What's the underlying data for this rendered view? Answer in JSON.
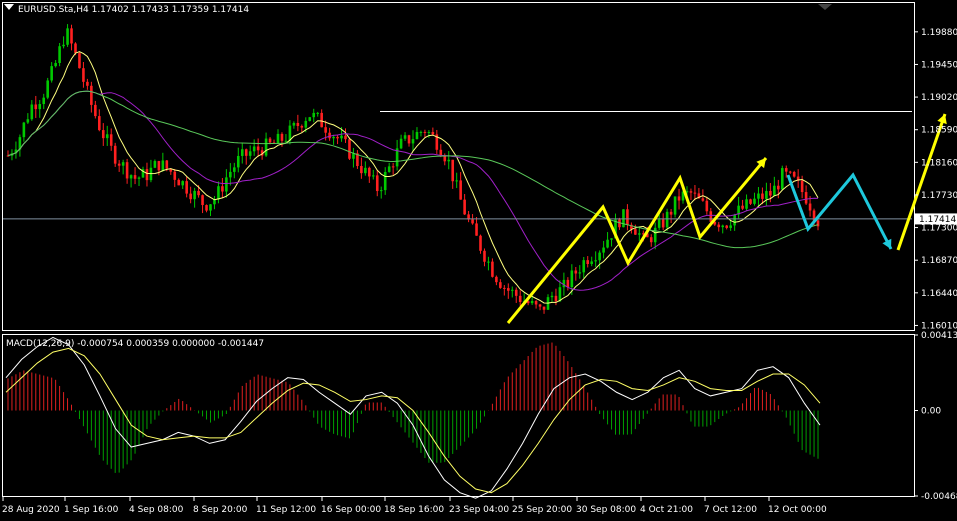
{
  "header": {
    "symbol_line": "EURUSD.Sta,H4  1.17402 1.17433 1.17359 1.17414"
  },
  "macd": {
    "label": "MACD(12,26,9) -0.000754 0.000359 0.000000 -0.001447",
    "levels": [
      "0.004136",
      "0.00",
      "-0.004681"
    ]
  },
  "colors": {
    "background": "#000000",
    "bull": "#00c800",
    "bear": "#ff2020",
    "ma_fast": "#ffff80",
    "ma_mid": "#a020c8",
    "ma_slow": "#5ac85a",
    "arrow_yellow": "#ffff00",
    "arrow_cyan": "#1ec8dc",
    "macd_pos": "#e02020",
    "macd_neg": "#00a000",
    "macd_main": "#ffffff",
    "macd_signal": "#ffff66",
    "price_tag_bg": "#ffffff",
    "price_tag_text": "#000000"
  },
  "chart_data": {
    "type": "candlestick",
    "symbol": "EURUSD.Sta",
    "timeframe": "H4",
    "ohlc_current": {
      "open": 1.17402,
      "high": 1.17433,
      "low": 1.17359,
      "close": 1.17414
    },
    "price_levels": [
      "1.19880",
      "1.19450",
      "1.19020",
      "1.18590",
      "1.18160",
      "1.17730",
      "1.17300",
      "1.16870",
      "1.16440",
      "1.16010"
    ],
    "current_price_label": "1.17414",
    "current_price": 1.17414,
    "horizontal_line_price": 1.1883,
    "ylim": [
      1.1595,
      1.2026
    ],
    "x_labels": [
      "28 Aug 2020",
      "1 Sep 16:00",
      "4 Sep 08:00",
      "8 Sep 20:00",
      "11 Sep 12:00",
      "16 Sep 00:00",
      "18 Sep 16:00",
      "23 Sep 04:00",
      "25 Sep 20:00",
      "30 Sep 08:00",
      "4 Oct 21:00",
      "7 Oct 12:00",
      "12 Oct 00:00"
    ],
    "price_path_close": [
      1.1825,
      1.185,
      1.189,
      1.1905,
      1.194,
      1.199,
      1.195,
      1.19,
      1.186,
      1.183,
      1.181,
      1.1795,
      1.18,
      1.1815,
      1.1805,
      1.179,
      1.1775,
      1.176,
      1.177,
      1.18,
      1.182,
      1.183,
      1.1835,
      1.184,
      1.185,
      1.1865,
      1.188,
      1.187,
      1.1855,
      1.184,
      1.182,
      1.18,
      1.178,
      1.181,
      1.184,
      1.185,
      1.186,
      1.1845,
      1.182,
      1.177,
      1.173,
      1.17,
      1.167,
      1.165,
      1.164,
      1.163,
      1.162,
      1.164,
      1.165,
      1.167,
      1.169,
      1.17,
      1.172,
      1.1745,
      1.1735,
      1.171,
      1.1725,
      1.1745,
      1.177,
      1.1775,
      1.176,
      1.174,
      1.1735,
      1.175,
      1.176,
      1.177,
      1.1775,
      1.18,
      1.179,
      1.177,
      1.174
    ],
    "macd_main": [
      0.0018,
      0.0028,
      0.0035,
      0.004,
      0.0036,
      0.0025,
      0.0008,
      -0.001,
      -0.002,
      -0.0018,
      -0.0016,
      -0.0012,
      -0.0014,
      -0.0018,
      -0.0016,
      -0.0006,
      0.0005,
      0.0012,
      0.0018,
      0.0017,
      0.001,
      0.0004,
      -0.0002,
      0.0008,
      0.001,
      0.0004,
      -0.0008,
      -0.0025,
      -0.0038,
      -0.0045,
      -0.0048,
      -0.0044,
      -0.0032,
      -0.0018,
      -0.0002,
      0.0012,
      0.0018,
      0.002,
      0.0016,
      0.001,
      0.0006,
      0.001,
      0.0018,
      0.0022,
      0.0012,
      0.0008,
      0.001,
      0.0012,
      0.0022,
      0.0024,
      0.0018,
      0.0004,
      -0.0008
    ],
    "macd_signal": [
      0.001,
      0.0018,
      0.0026,
      0.0032,
      0.0034,
      0.003,
      0.002,
      0.0006,
      -0.0008,
      -0.0014,
      -0.0016,
      -0.0015,
      -0.0014,
      -0.0015,
      -0.0015,
      -0.0012,
      -0.0004,
      0.0004,
      0.0011,
      0.0015,
      0.0014,
      0.001,
      0.0005,
      0.0006,
      0.0008,
      0.0007,
      0.0,
      -0.0012,
      -0.0025,
      -0.0036,
      -0.0043,
      -0.0045,
      -0.004,
      -0.003,
      -0.0018,
      -0.0005,
      0.0006,
      0.0014,
      0.0017,
      0.0016,
      0.0012,
      0.0011,
      0.0014,
      0.0018,
      0.0016,
      0.0012,
      0.0011,
      0.0011,
      0.0016,
      0.002,
      0.002,
      0.0014,
      0.0004
    ],
    "macd_ylim": [
      -0.004681,
      0.004136
    ]
  }
}
